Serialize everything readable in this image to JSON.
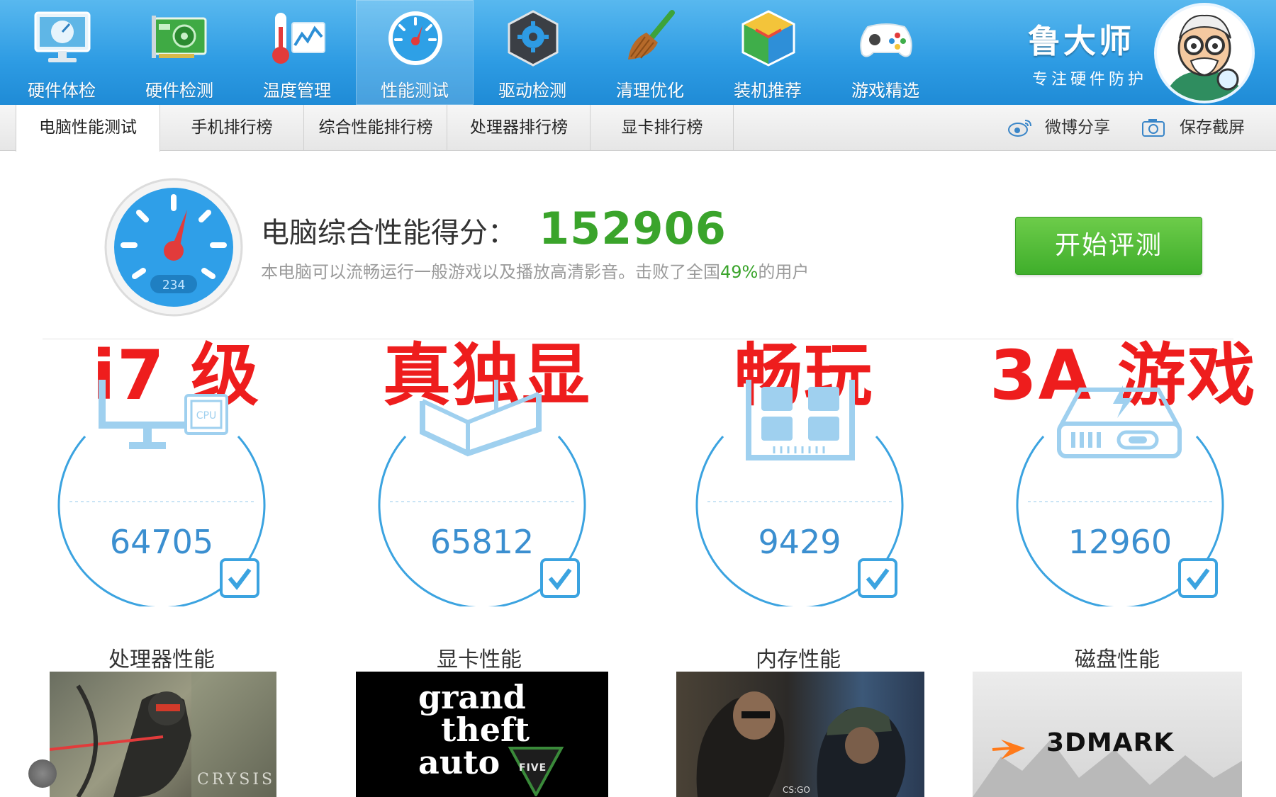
{
  "toolbar": {
    "items": [
      {
        "label": "硬件体检",
        "icon": "monitor-icon"
      },
      {
        "label": "硬件检测",
        "icon": "graphics-card-icon"
      },
      {
        "label": "温度管理",
        "icon": "thermometer-icon"
      },
      {
        "label": "性能测试",
        "icon": "speedometer-icon",
        "active": true
      },
      {
        "label": "驱动检测",
        "icon": "driver-gear-icon"
      },
      {
        "label": "清理优化",
        "icon": "broom-icon"
      },
      {
        "label": "装机推荐",
        "icon": "cube-icon"
      },
      {
        "label": "游戏精选",
        "icon": "gamepad-icon"
      }
    ],
    "brand": {
      "name": "鲁大师",
      "slogan": "专注硬件防护",
      "icon": "mascot-avatar-icon"
    }
  },
  "subtabs": {
    "items": [
      "电脑性能测试",
      "手机排行榜",
      "综合性能排行榜",
      "处理器排行榜",
      "显卡排行榜"
    ],
    "active_index": 0,
    "share_label": "微博分享",
    "screenshot_label": "保存截屏"
  },
  "score": {
    "label": "电脑综合性能得分：",
    "value": "152906",
    "gauge_number": "234",
    "desc_before": "本电脑可以流畅运行一般游戏以及播放高清影音。击败了全国",
    "desc_percent": "49%",
    "desc_after": "的用户",
    "start_button": "开始评测"
  },
  "captions": [
    "i7 级",
    "真独显",
    "畅玩",
    "3A 游戏"
  ],
  "metrics": [
    {
      "name": "处理器性能",
      "value": "64705",
      "icon": "cpu-monitor-icon"
    },
    {
      "name": "显卡性能",
      "value": "65812",
      "icon": "gpu-cube-icon"
    },
    {
      "name": "内存性能",
      "value": "9429",
      "icon": "memory-chip-icon"
    },
    {
      "name": "磁盘性能",
      "value": "12960",
      "icon": "disk-drive-icon"
    }
  ],
  "thumbnails": [
    {
      "title": "CRYSIS"
    },
    {
      "title_lines": [
        "grand",
        "theft",
        "auto"
      ],
      "badge": "FIVE"
    },
    {
      "title": "CS:GO"
    },
    {
      "title": "3DMARK"
    }
  ],
  "colors": {
    "toolbar_blue": "#2d9be3",
    "score_green": "#3aa42b",
    "caption_red": "#ee1d1d",
    "ring_blue": "#3ba3e0"
  }
}
